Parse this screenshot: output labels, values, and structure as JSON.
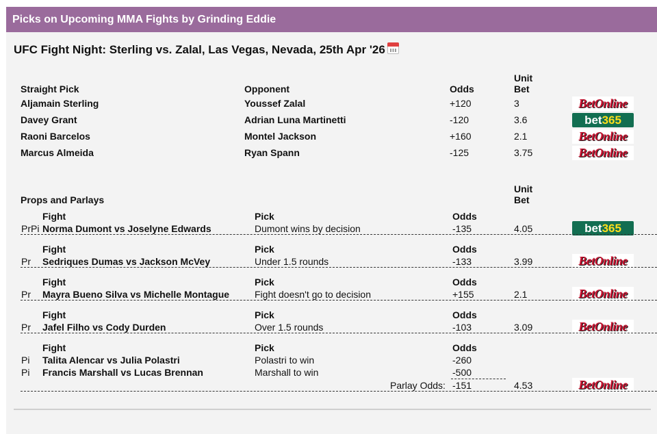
{
  "header": {
    "title": "Picks on Upcoming MMA Fights by Grinding Eddie"
  },
  "event": {
    "title": "UFC Fight Night: Sterling vs. Zalal, Las Vegas, Nevada, 25th Apr '26",
    "icon": "calendar-icon"
  },
  "straight": {
    "headers": {
      "pick": "Straight Pick",
      "opponent": "Opponent",
      "odds": "Odds",
      "unit1": "Unit",
      "unit2": "Bet"
    },
    "rows": [
      {
        "pick": "Aljamain Sterling",
        "opponent": "Youssef Zalal",
        "odds": "+120",
        "unit": "3",
        "book": "BetOnline"
      },
      {
        "pick": "Davey Grant",
        "opponent": "Adrian Luna Martinetti",
        "odds": "-120",
        "unit": "3.6",
        "book": "bet365"
      },
      {
        "pick": "Raoni Barcelos",
        "opponent": "Montel Jackson",
        "odds": "+160",
        "unit": "2.1",
        "book": "BetOnline"
      },
      {
        "pick": "Marcus Almeida",
        "opponent": "Ryan Spann",
        "odds": "-125",
        "unit": "3.75",
        "book": "BetOnline"
      }
    ]
  },
  "props": {
    "title": "Props and Parlays",
    "unit1": "Unit",
    "unit2": "Bet",
    "col_fight": "Fight",
    "col_pick": "Pick",
    "col_odds": "Odds",
    "parlay_label": "Parlay Odds:",
    "groups": [
      {
        "legs": [
          {
            "type": "PrPi",
            "fight": "Norma Dumont vs Joselyne Edwards",
            "pick": "Dumont wins by decision",
            "odds": "-135"
          }
        ],
        "unit": "4.05",
        "book": "bet365"
      },
      {
        "legs": [
          {
            "type": "Pr",
            "fight": "Sedriques Dumas vs Jackson McVey",
            "pick": "Under 1.5 rounds",
            "odds": "-133"
          }
        ],
        "unit": "3.99",
        "book": "BetOnline"
      },
      {
        "legs": [
          {
            "type": "Pr",
            "fight": "Mayra Bueno Silva vs Michelle Montague",
            "pick": "Fight doesn't go to decision",
            "odds": "+155"
          }
        ],
        "unit": "2.1",
        "book": "BetOnline"
      },
      {
        "legs": [
          {
            "type": "Pr",
            "fight": "Jafel Filho vs Cody Durden",
            "pick": "Over 1.5 rounds",
            "odds": "-103"
          }
        ],
        "unit": "3.09",
        "book": "BetOnline"
      },
      {
        "legs": [
          {
            "type": "Pi",
            "fight": "Talita Alencar vs Julia Polastri",
            "pick": "Polastri to win",
            "odds": "-260"
          },
          {
            "type": "Pi",
            "fight": "Francis Marshall vs Lucas Brennan",
            "pick": "Marshall to win",
            "odds": "-500"
          }
        ],
        "parlay_odds": "-151",
        "unit": "4.53",
        "book": "BetOnline"
      }
    ]
  },
  "logos": {
    "betonline": "BetOnline",
    "bet365_a": "bet",
    "bet365_b": "365"
  },
  "colors": {
    "header_bg": "#9a6b9c",
    "betonline_red": "#c8102e",
    "bet365_green": "#126e51",
    "bet365_yellow": "#ffdf1b"
  }
}
